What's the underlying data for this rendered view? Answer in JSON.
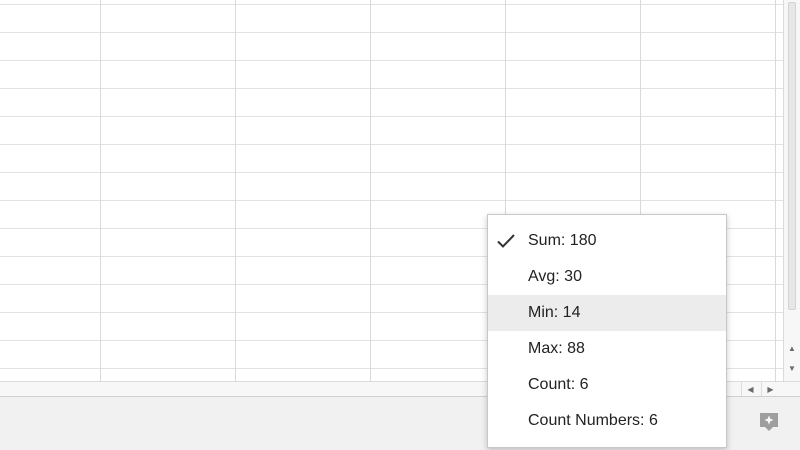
{
  "summary_menu": {
    "items": [
      {
        "label": "Sum: 180",
        "checked": true
      },
      {
        "label": "Avg: 30",
        "checked": false
      },
      {
        "label": "Min: 14",
        "checked": false,
        "hovered": true
      },
      {
        "label": "Max: 88",
        "checked": false
      },
      {
        "label": "Count: 6",
        "checked": false
      },
      {
        "label": "Count Numbers: 6",
        "checked": false
      }
    ]
  },
  "icons": {
    "check": "check-icon",
    "explore": "explore-icon",
    "scroll_up": "arrow-up-icon",
    "scroll_down": "arrow-down-icon",
    "scroll_left": "arrow-left-icon",
    "scroll_right": "arrow-right-icon"
  },
  "colors": {
    "menu_hover": "#ececec",
    "gridline": "#e2e2e2",
    "explore_icon": "#9e9e9e",
    "bottom_bar": "#f1f1f1"
  }
}
